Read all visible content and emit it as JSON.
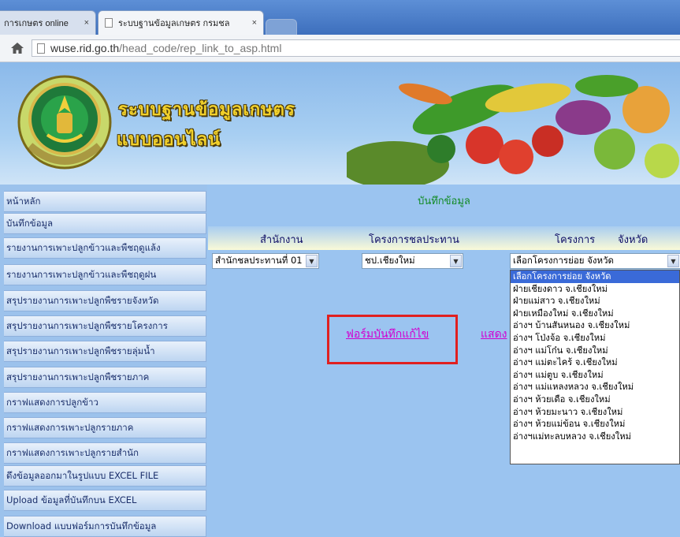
{
  "browser": {
    "tabs": [
      {
        "label": "การเกษตร online",
        "close": "×"
      },
      {
        "label": "ระบบฐานข้อมูลเกษตร กรมชล",
        "close": "×"
      }
    ],
    "url_host": "wuse.rid.go.th",
    "url_path": "/head_code/rep_link_to_asp.html"
  },
  "banner": {
    "title_line1": "ระบบฐานข้อมูลเกษตร",
    "title_line2": "แบบออนไลน์",
    "seal_text": "กรมชลประทาน"
  },
  "sidebar": {
    "items": [
      {
        "label": "หน้าหลัก"
      },
      {
        "label": "บันทึกข้อมูล"
      },
      {
        "label": "รายงานการเพาะปลูกข้าวและพืชฤดูแล้ง"
      },
      {
        "label": "รายงานการเพาะปลูกข้าวและพืชฤดูฝน"
      },
      {
        "label": "สรุปรายงานการเพาะปลูกพืชรายจังหวัด"
      },
      {
        "label": "สรุปรายงานการเพาะปลูกพืชรายโครงการ"
      },
      {
        "label": "สรุปรายงานการเพาะปลูกพืชรายลุ่มน้ำ"
      },
      {
        "label": "สรุปรายงานการเพาะปลูกพืชรายภาค"
      },
      {
        "label": "กราฟแสดงการปลูกข้าว"
      },
      {
        "label": "กราฟแสดงการเพาะปลูกรายภาค"
      },
      {
        "label": "กราฟแสดงการเพาะปลูกรายสำนัก"
      },
      {
        "label": "ดึงข้อมูลออกมาในรูปแบบ EXCEL FILE"
      },
      {
        "label": "Upload ข้อมูลที่บันทึกบน EXCEL"
      },
      {
        "label": "Download แบบฟอร์มการบันทึกข้อมูล"
      }
    ]
  },
  "main": {
    "title": "บันทึกข้อมูล",
    "headers": {
      "office": "สำนักงาน",
      "irrigation_project": "โครงการชลประทาน",
      "project": "โครงการ",
      "province": "จังหวัด"
    },
    "selects": {
      "office": "สำนักชลประทานที่ 01",
      "irrigation_project": "ชป.เชียงใหม่",
      "sub_project": "เลือกโครงการย่อย   จังหวัด"
    },
    "dropdown_options": [
      "เลือกโครงการย่อย   จังหวัด",
      "ฝ่ายเชียงดาว   จ.เชียงใหม่",
      "ฝ่ายแม่สาว   จ.เชียงใหม่",
      "ฝ่ายเหมืองใหม่   จ.เชียงใหม่",
      "อ่างฯ บ้านสันหนอง   จ.เชียงใหม่",
      "อ่างฯ โป่งจ้อ   จ.เชียงใหม่",
      "อ่างฯ แม่โก๋น   จ.เชียงใหม่",
      "อ่างฯ แม่ตะไคร้   จ.เชียงใหม่",
      "อ่างฯ แม่ตูบ   จ.เชียงใหม่",
      "อ่างฯ แม่แหลงหลวง   จ.เชียงใหม่",
      "อ่างฯ ห้วยเดือ   จ.เชียงใหม่",
      "อ่างฯ ห้วยมะนาว   จ.เชียงใหม่",
      "อ่างฯ ห้วยแม่ข้อน   จ.เชียงใหม่",
      "อ่างฯแม่ทะลบหลวง   จ.เชียงใหม่"
    ],
    "form_link": "ฟอร์มบันทึกแก้ไข",
    "show_link": "แสดง"
  },
  "colors": {
    "accent_highlight": "#3a6ad8",
    "link": "#d000d0",
    "title_green": "#118a24",
    "callout_red": "#e02020"
  }
}
